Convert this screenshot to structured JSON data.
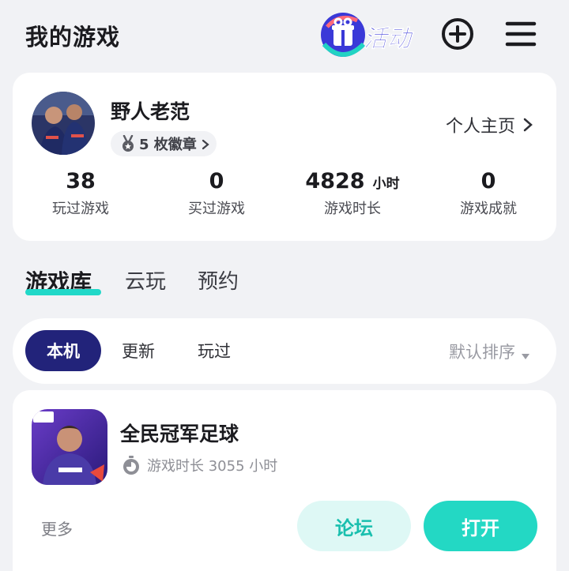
{
  "header": {
    "title": "我的游戏",
    "activity_label": "活动"
  },
  "profile": {
    "username": "野人老范",
    "badge_label": "5 枚徽章",
    "profile_link": "个人主页",
    "stats": [
      {
        "value": "38",
        "unit": "",
        "label": "玩过游戏"
      },
      {
        "value": "0",
        "unit": "",
        "label": "买过游戏"
      },
      {
        "value": "4828",
        "unit": "小时",
        "label": "游戏时长"
      },
      {
        "value": "0",
        "unit": "",
        "label": "游戏成就"
      }
    ]
  },
  "library_tabs": [
    {
      "label": "游戏库",
      "active": true
    },
    {
      "label": "云玩",
      "active": false
    },
    {
      "label": "预约",
      "active": false
    }
  ],
  "filters": {
    "chips": [
      {
        "label": "本机",
        "active": true
      },
      {
        "label": "更新",
        "active": false
      },
      {
        "label": "玩过",
        "active": false
      }
    ],
    "sort_label": "默认排序"
  },
  "game": {
    "title": "全民冠军足球",
    "playtime": "游戏时长 3055 小时",
    "icon_badge": "FIFPro",
    "more_label": "更多",
    "forum_label": "论坛",
    "open_label": "打开"
  },
  "colors": {
    "accent": "#23d8c4",
    "filter_active": "#22237a",
    "background": "#f1f2f5"
  }
}
